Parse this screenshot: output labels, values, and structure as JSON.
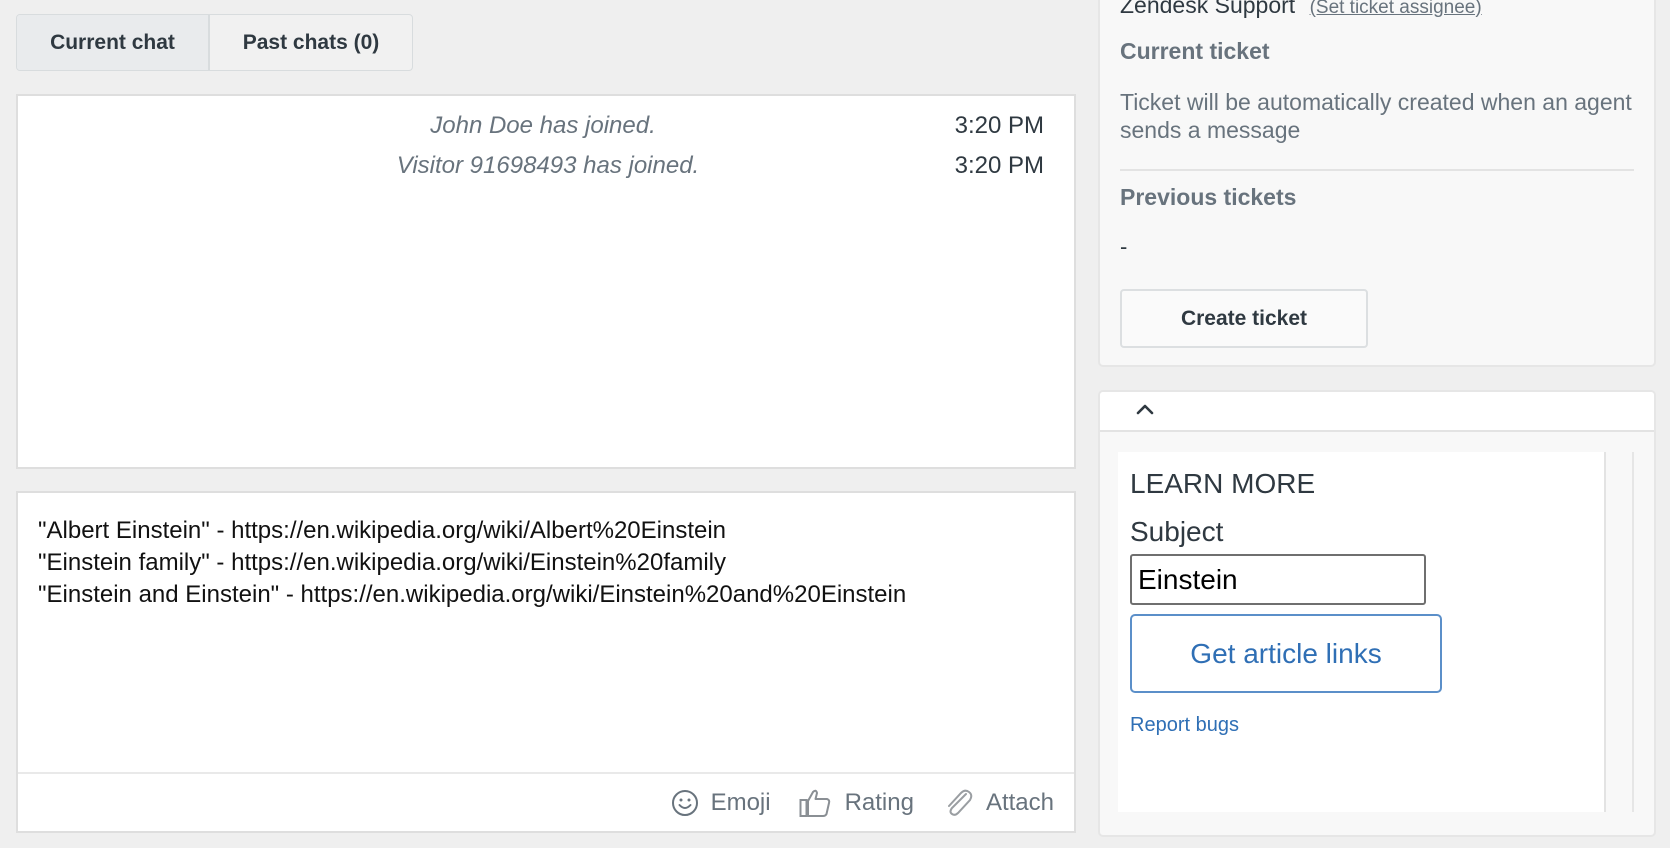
{
  "tabs": [
    {
      "label": "Current chat",
      "active": true
    },
    {
      "label": "Past chats (0)",
      "active": false
    }
  ],
  "chat_log": {
    "messages": [
      {
        "text": "John Doe has joined.",
        "time": "3:20 PM"
      },
      {
        "text": "Visitor 91698493 has joined.",
        "time": "3:20 PM"
      }
    ]
  },
  "composer": {
    "text": "\"Albert Einstein\" - https://en.wikipedia.org/wiki/Albert%20Einstein\n\"Einstein family\" - https://en.wikipedia.org/wiki/Einstein%20family\n\"Einstein and Einstein\" - https://en.wikipedia.org/wiki/Einstein%20and%20Einstein",
    "toolbar": {
      "emoji_label": "Emoji",
      "rating_label": "Rating",
      "attach_label": "Attach",
      "icons": {
        "emoji": "smiley-icon",
        "rating": "thumbs-up-icon",
        "attach": "paperclip-icon"
      }
    }
  },
  "ticket_panel": {
    "zendesk_label": "Zendesk Support",
    "set_assignee_link": "(Set ticket assignee)",
    "current_ticket_title": "Current ticket",
    "current_ticket_desc": "Ticket will be automatically created when an agent sends a message",
    "previous_tickets_title": "Previous tickets",
    "previous_tickets_value": "-",
    "create_ticket_label": "Create ticket"
  },
  "app_panel": {
    "collapse_icon": "chevron-up-icon",
    "heading": "LEARN MORE",
    "subject_label": "Subject",
    "subject_value": "Einstein",
    "get_links_label": "Get article links",
    "report_bugs_label": "Report bugs"
  },
  "colors": {
    "link_blue": "#2f6fb5",
    "muted_text": "#68737d",
    "dark_text": "#2f3941",
    "background": "#efefef"
  }
}
